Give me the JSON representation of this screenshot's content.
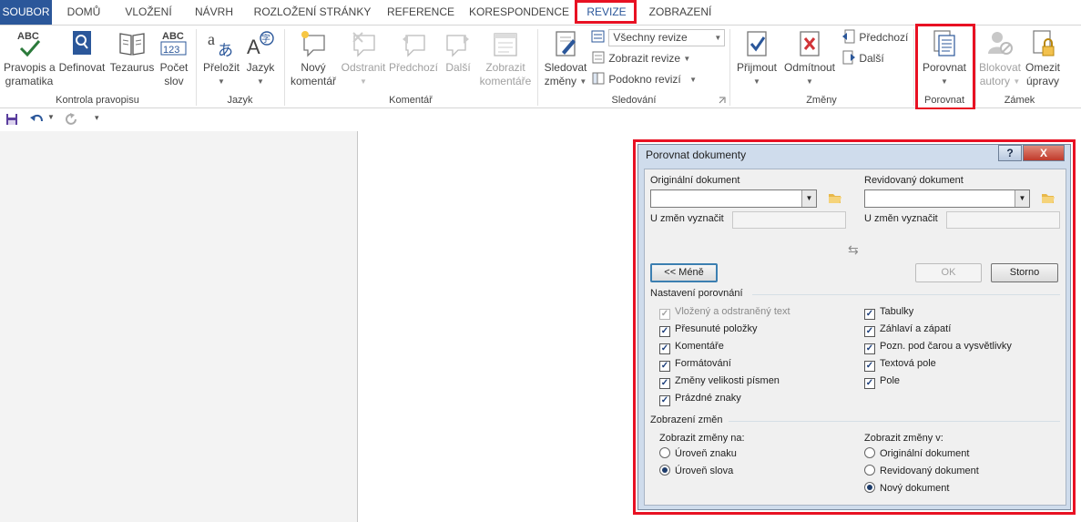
{
  "tabs": [
    {
      "label": "SOUBOR"
    },
    {
      "label": "DOMŮ"
    },
    {
      "label": "VLOŽENÍ"
    },
    {
      "label": "NÁVRH"
    },
    {
      "label": "ROZLOŽENÍ STRÁNKY"
    },
    {
      "label": "REFERENCE"
    },
    {
      "label": "KORESPONDENCE"
    },
    {
      "label": "REVIZE"
    },
    {
      "label": "ZOBRAZENÍ"
    }
  ],
  "ribbon": {
    "proofing": {
      "spelling_l1": "Pravopis a",
      "spelling_l2": "gramatika",
      "define": "Definovat",
      "thesaurus": "Tezaurus",
      "count_l1": "Počet",
      "count_l2": "slov",
      "group": "Kontrola pravopisu"
    },
    "language": {
      "translate": "Přeložit",
      "language": "Jazyk",
      "group": "Jazyk"
    },
    "comments": {
      "new_l1": "Nový",
      "new_l2": "komentář",
      "delete": "Odstranit",
      "previous": "Předchozí",
      "next": "Další",
      "show_l1": "Zobrazit",
      "show_l2": "komentáře",
      "group": "Komentář"
    },
    "tracking": {
      "track_l1": "Sledovat",
      "track_l2": "změny",
      "markup_select": "Všechny revize",
      "show_markup": "Zobrazit revize",
      "pane": "Podokno revizí",
      "group": "Sledování"
    },
    "changes": {
      "accept": "Přijmout",
      "reject": "Odmítnout",
      "previous": "Předchozí",
      "next": "Další",
      "group": "Změny"
    },
    "compare": {
      "compare": "Porovnat",
      "group": "Porovnat"
    },
    "protect": {
      "block_l1": "Blokovat",
      "block_l2": "autory",
      "restrict_l1": "Omezit",
      "restrict_l2": "úpravy",
      "group": "Zámek"
    }
  },
  "dialog": {
    "title": "Porovnat dokumenty",
    "help_btn": "?",
    "close_btn": "X",
    "original_label": "Originální dokument",
    "revised_label": "Revidovaný dokument",
    "label_changes_with": "U změn vyznačit",
    "swap_icon": "⇆",
    "less_button": "<< Méně",
    "ok_button": "OK",
    "cancel_button": "Storno",
    "comparison_settings": "Nastavení porovnání",
    "settings_left": [
      {
        "label": "Vložený a odstraněný text",
        "checked": true,
        "disabled": true
      },
      {
        "label": "Přesunuté položky",
        "checked": true,
        "disabled": false
      },
      {
        "label": "Komentáře",
        "checked": true,
        "disabled": false
      },
      {
        "label": "Formátování",
        "checked": true,
        "disabled": false
      },
      {
        "label": "Změny velikosti písmen",
        "checked": true,
        "disabled": false
      },
      {
        "label": "Prázdné znaky",
        "checked": true,
        "disabled": false
      }
    ],
    "settings_right": [
      {
        "label": "Tabulky",
        "checked": true
      },
      {
        "label": "Záhlaví a zápatí",
        "checked": true
      },
      {
        "label": "Pozn. pod čarou a vysvětlivky",
        "checked": true
      },
      {
        "label": "Textová pole",
        "checked": true
      },
      {
        "label": "Pole",
        "checked": true
      }
    ],
    "show_changes": "Zobrazení změn",
    "show_changes_at": "Zobrazit změny na:",
    "level_options": [
      {
        "label": "Úroveň znaku",
        "selected": false
      },
      {
        "label": "Úroveň slova",
        "selected": true
      }
    ],
    "show_changes_in": "Zobrazit změny v:",
    "target_options": [
      {
        "label": "Originální dokument",
        "selected": false
      },
      {
        "label": "Revidovaný dokument",
        "selected": false
      },
      {
        "label": "Nový dokument",
        "selected": true
      }
    ]
  },
  "colors": {
    "file_tab": "#2b579a",
    "highlight": "#e81123",
    "dialog_frame": "#cfdcec"
  }
}
